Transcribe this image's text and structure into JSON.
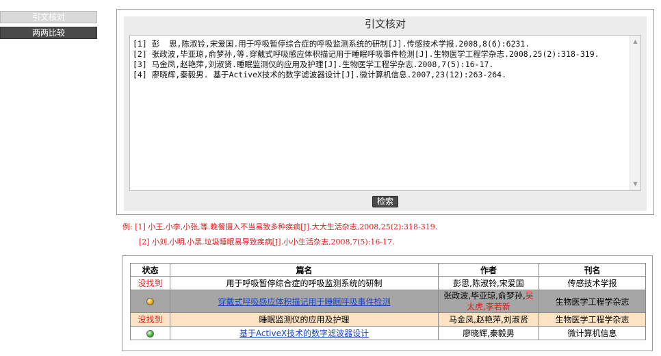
{
  "nav": {
    "items": [
      {
        "label": "引文核对"
      },
      {
        "label": "两两比较"
      }
    ]
  },
  "panel": {
    "title": "引文核对",
    "references_text": "[1] 彭  思,陈淑铃,宋爱国.用于呼吸暂停综合症的呼吸监测系统的研制[J].传感技术学报.2008,8(6):6231.\n[2] 张政波,毕亚琼,俞梦孙,等.穿戴式呼吸感应体积描记用于睡眠呼吸事件检测[J].生物医学工程学杂志.2008,25(2):318-319.\n[3] 马金凤,赵艳萍,刘淑贤.睡眠监测仪的应用及护理[J].生物医学工程学杂志.2008,7(5):16-17.\n[4] 廖晓辉,秦毅男. 基于ActiveX技术的数字滤波器设计[J].微计算机信息.2007,23(12):263-264.",
    "search_label": "检索"
  },
  "examples": {
    "line1": "例: [1] 小王,小李,小张,等.晚餐摄入不当易致多种疾病[J].大大生活杂志,2008,25(2):318-319.",
    "line2": "[2] 小刘,小明,小黑.垃圾睡眠易导致疾病[J].小小生活杂志,2008,7(5):16-17."
  },
  "results": {
    "headers": [
      "状态",
      "篇名",
      "作者",
      "刊名"
    ],
    "rows": [
      {
        "status": "没找到",
        "title": "用于呼吸暂停综合症的呼吸监测系统的研制",
        "authors": "彭思,陈淑铃,宋爱国",
        "authors_extra": "",
        "journal": "传感技术学报"
      },
      {
        "status": "",
        "status_icon": "orange-dot-icon",
        "title": "穿戴式呼吸感应体积描记用于睡眠呼吸事件检测",
        "authors": "张政波,毕亚琼,俞梦孙,",
        "authors_extra": "吴太虎,李若新",
        "journal": "生物医学工程学杂志"
      },
      {
        "status": "没找到",
        "title": "睡眠监测仪的应用及护理",
        "authors": "马金凤,赵艳萍,刘淑贤",
        "authors_extra": "",
        "journal": "生物医学工程学杂志"
      },
      {
        "status": "",
        "status_icon": "green-dot-icon",
        "title": "基于ActiveX技术的数字滤波器设计",
        "authors": "廖晓辉,秦毅男",
        "authors_extra": "",
        "journal": "微计算机信息"
      }
    ]
  },
  "colors": {
    "accent_red": "#e01b1b",
    "link_blue": "#1a44c6",
    "row_gray": "#a6a6a6",
    "row_peach": "#fde3c2",
    "dark_button": "#4a4a4a"
  }
}
